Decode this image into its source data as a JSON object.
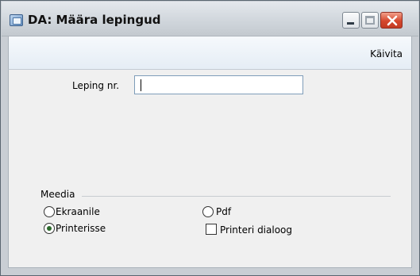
{
  "window": {
    "title": "DA: Määra lepingud"
  },
  "toolbar": {
    "run_label": "Käivita"
  },
  "form": {
    "contract_label": "Leping nr.",
    "contract_value": ""
  },
  "media": {
    "section_label": "Meedia",
    "options": [
      {
        "label": "Ekraanile",
        "selected": false
      },
      {
        "label": "Pdf",
        "selected": false
      },
      {
        "label": "Printerisse",
        "selected": true
      }
    ],
    "printer_dialog": {
      "label": "Printeri dialoog",
      "checked": false
    }
  }
}
